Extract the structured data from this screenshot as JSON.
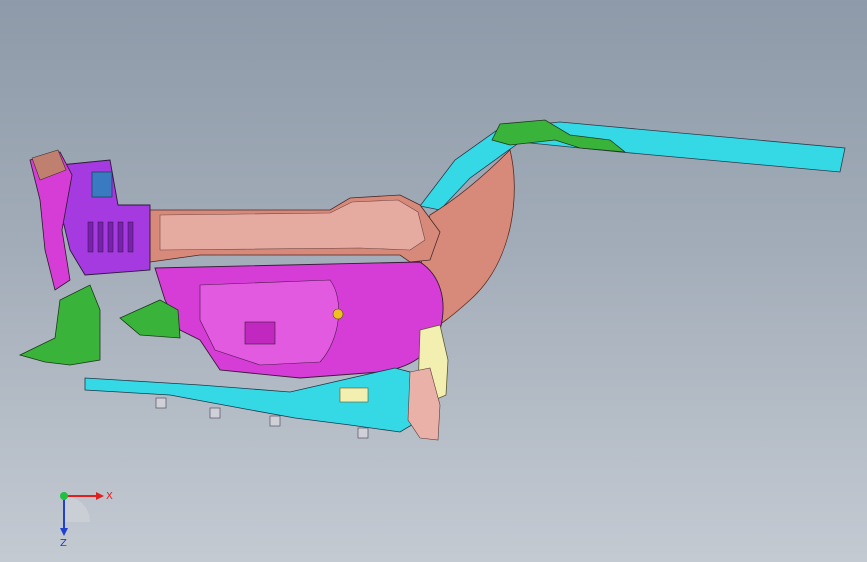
{
  "viewport": {
    "background_top": "#8e9aa9",
    "background_bottom": "#c4cad2"
  },
  "model": {
    "part_colors": {
      "magenta": "#d63cd6",
      "purple": "#a43ae0",
      "salmon": "#d88a7a",
      "pink": "#e9b1a7",
      "cyan": "#35d9e6",
      "green": "#39b33a",
      "yellow": "#f2efb0",
      "edge": "#3a2a3a"
    }
  },
  "triad": {
    "x_label": "X",
    "z_label": "Z",
    "x_color": "#e02020",
    "z_color": "#2040d0",
    "origin_color": "#20c040"
  }
}
